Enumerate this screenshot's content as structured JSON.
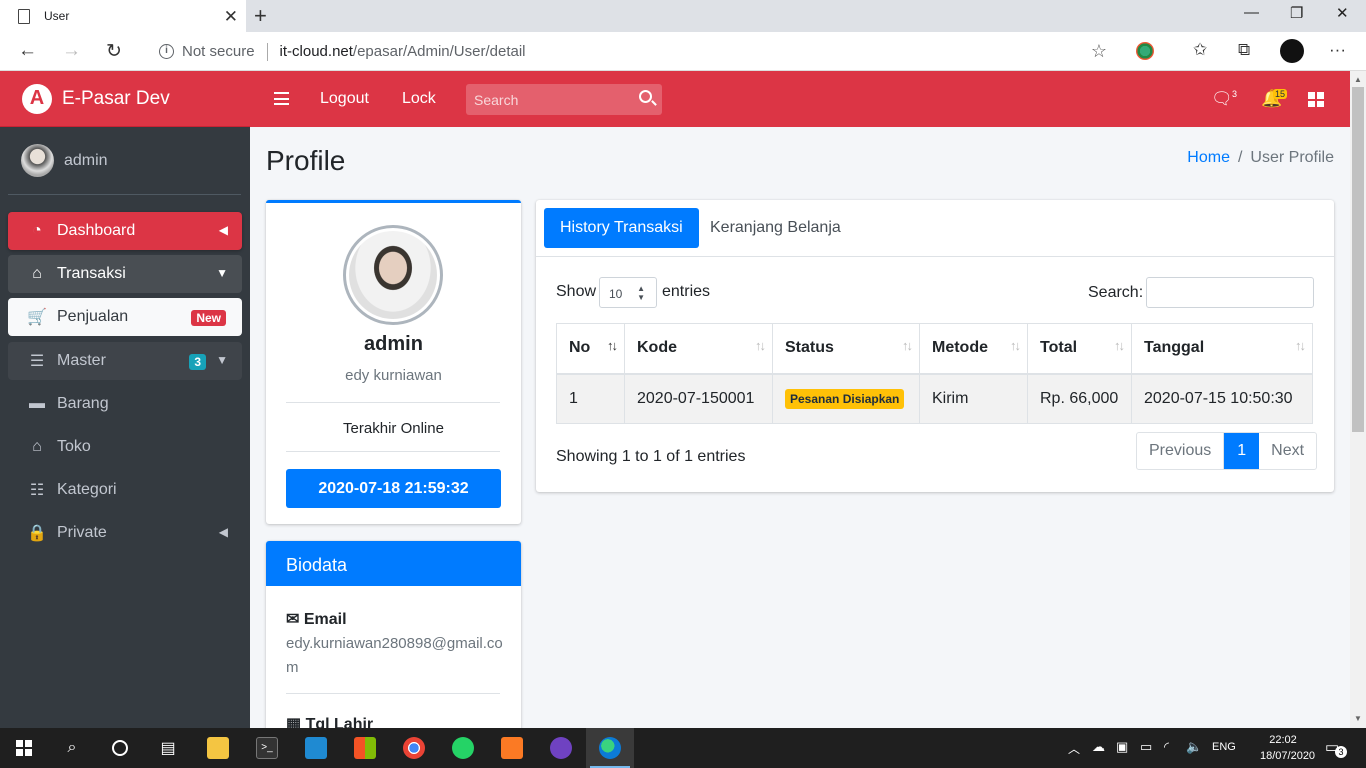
{
  "browser": {
    "tab_title": "User",
    "url_secure": "Not secure",
    "url_host": "it-cloud.net",
    "url_path": "/epasar/Admin/User/detail"
  },
  "app": {
    "brand": "E-Pasar Dev",
    "brand_logo": "A",
    "accent": "#dc3545",
    "primary": "#007bff"
  },
  "navbar": {
    "logout": "Logout",
    "lock": "Lock",
    "search_placeholder": "Search",
    "messages_count": "3",
    "notifications_count": "15"
  },
  "sidebar": {
    "user_name": "admin",
    "items": [
      {
        "label": "Dashboard",
        "icon": "tachometer-icon"
      },
      {
        "label": "Transaksi",
        "icon": "store-icon"
      },
      {
        "label": "Penjualan",
        "icon": "cart-icon",
        "badge": "New"
      },
      {
        "label": "Master",
        "icon": "database-icon",
        "badge": "3"
      },
      {
        "label": "Barang",
        "icon": "briefcase-icon"
      },
      {
        "label": "Toko",
        "icon": "store-icon"
      },
      {
        "label": "Kategori",
        "icon": "list-icon"
      },
      {
        "label": "Private",
        "icon": "lock-icon"
      }
    ]
  },
  "page": {
    "title": "Profile",
    "breadcrumb_home": "Home",
    "breadcrumb_sep": "/",
    "breadcrumb_current": "User Profile"
  },
  "profile": {
    "username": "admin",
    "fullname": "edy kurniawan",
    "last_online_label": "Terakhir Online",
    "last_online_value": "2020-07-18 21:59:32"
  },
  "biodata": {
    "title": "Biodata",
    "email_label": "Email",
    "email_value": "edy.kurniawan280898@gmail.com",
    "dob_label": "Tgl Lahir"
  },
  "tabs": [
    "History Transaksi",
    "Keranjang Belanja"
  ],
  "datatable": {
    "show_label": "Show",
    "entries_value": "10",
    "entries_label": "entries",
    "search_label": "Search:",
    "columns": [
      "No",
      "Kode",
      "Status",
      "Metode",
      "Total",
      "Tanggal"
    ],
    "rows": [
      {
        "no": "1",
        "kode": "2020-07-150001",
        "status": "Pesanan Disiapkan",
        "metode": "Kirim",
        "total": "Rp. 66,000",
        "tanggal": "2020-07-15 10:50:30"
      }
    ],
    "info": "Showing 1 to 1 of 1 entries",
    "pager": {
      "previous": "Previous",
      "current": "1",
      "next": "Next"
    }
  },
  "taskbar": {
    "lang": "ENG",
    "time": "22:02",
    "date": "18/07/2020",
    "notif_count": "3"
  }
}
